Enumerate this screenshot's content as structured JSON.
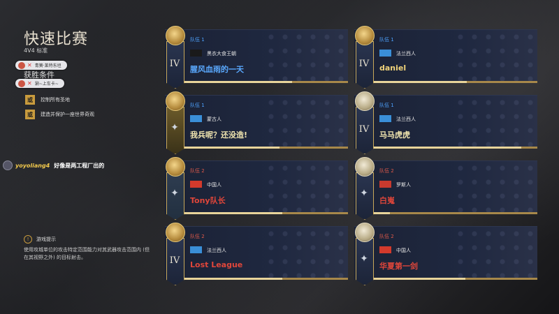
{
  "header": {
    "title": "快速比赛",
    "subtitle": "4V4 标准",
    "chips": [
      {
        "label": "青簧·莱特东坦"
      },
      {
        "label": "涮~上车卡~"
      }
    ]
  },
  "victory": {
    "title": "获胜条件",
    "or_label": "或",
    "conditions": [
      "控制所有圣地",
      "建造并保护一座世界奇观"
    ]
  },
  "chat": {
    "user": "yoyoliang4",
    "message": "好像是两工程厂出的"
  },
  "tip": {
    "title": "游戏提示",
    "text": "使用攻城单位的攻击特定范围能力对其武器攻击范围内 (但在其视野之外) 的目标射击。"
  },
  "players": [
    {
      "team": "队伍 1",
      "team_color": "#4ea3ff",
      "civ": "黑衣大食王朝",
      "name": "腥风血雨的一天",
      "name_style": "blue",
      "rank": "IV",
      "medal": "gold",
      "banner": "plain",
      "bar": 0.66
    },
    {
      "team": "队伍 1",
      "team_color": "#4ea3ff",
      "civ": "法兰西人",
      "name": "daniel",
      "name_style": "gold",
      "rank": "IV",
      "medal": "gold",
      "banner": "plain",
      "bar": 0.57
    },
    {
      "team": "队伍 1",
      "team_color": "#4ea3ff",
      "civ": "蒙古人",
      "name": "我兵呢？还没造!",
      "name_style": "yellow",
      "rank": "",
      "medal": "gold",
      "banner": "gold",
      "bar": 0.58
    },
    {
      "team": "队伍 1",
      "team_color": "#4ea3ff",
      "civ": "法兰西人",
      "name": "马马虎虎",
      "name_style": "yellow",
      "rank": "IV",
      "medal": "silver",
      "banner": "plain",
      "bar": 0.9
    },
    {
      "team": "队伍 2",
      "team_color": "#e05a4a",
      "civ": "中国人",
      "name": "Tony队长",
      "name_style": "red",
      "rank": "",
      "medal": "gold",
      "banner": "teal",
      "bar": 0.6
    },
    {
      "team": "队伍 2",
      "team_color": "#e05a4a",
      "civ": "罗斯人",
      "name": "白嵬",
      "name_style": "red",
      "rank": "",
      "medal": "silver",
      "banner": "plain",
      "bar": 0.1
    },
    {
      "team": "队伍 2",
      "team_color": "#e05a4a",
      "civ": "法兰西人",
      "name": "Lost League",
      "name_style": "red",
      "rank": "IV",
      "medal": "gold",
      "banner": "plain",
      "bar": 0.6
    },
    {
      "team": "队伍 2",
      "team_color": "#e05a4a",
      "civ": "中国人",
      "name": "华夏第一剑",
      "name_style": "red",
      "rank": "",
      "medal": "silver",
      "banner": "plain",
      "bar": 0.56
    }
  ],
  "flag_colors": {
    "法兰西人": "#3a8fd8",
    "中国人": "#d33a2c",
    "罗斯人": "#c83a2e",
    "蒙古人": "#3a8fd8",
    "黑衣大食王朝": "#1a1a1a"
  }
}
